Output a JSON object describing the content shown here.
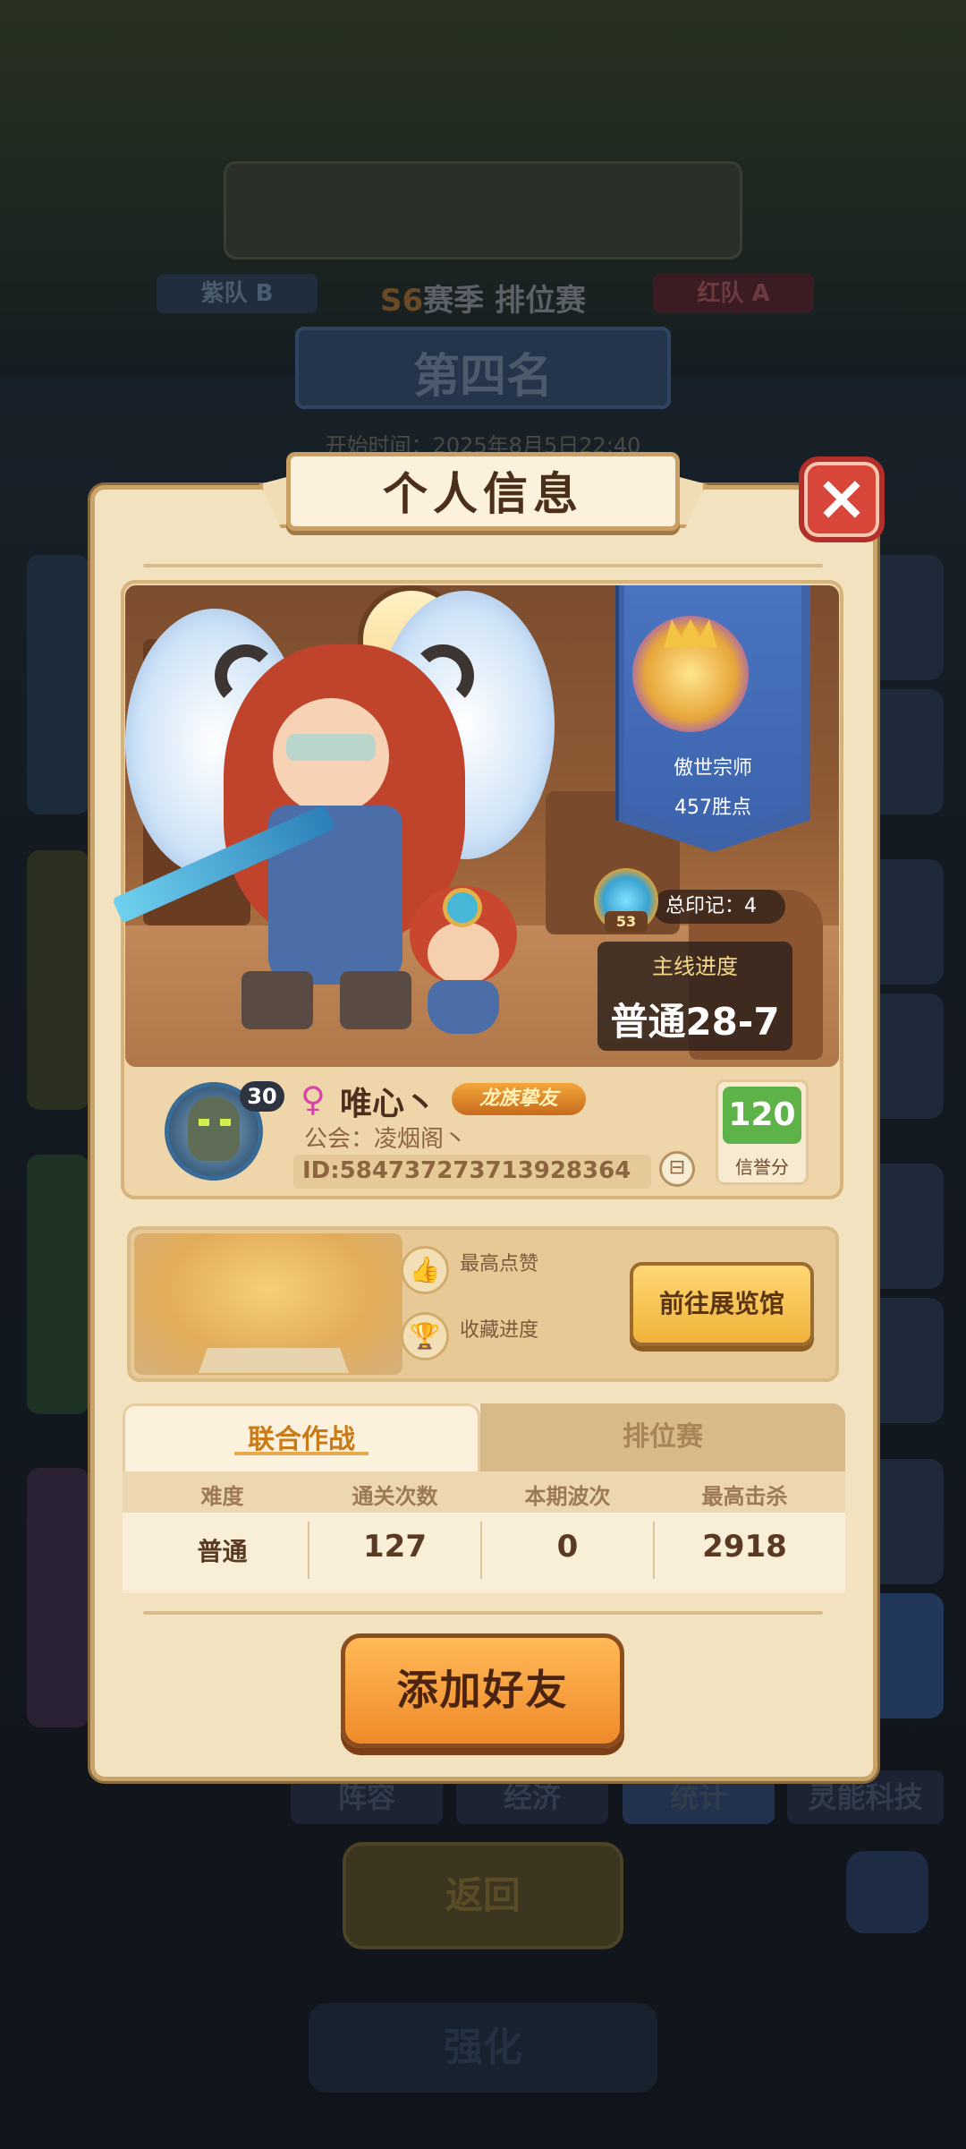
{
  "background": {
    "banner_text": "",
    "team_b": "紫队 B",
    "team_a": "红队 A",
    "season_prefix": "S6",
    "season_rest": "赛季 排位赛",
    "rank_plate": "第四名",
    "start_time": "开始时间：2025年8月5日22:40",
    "bottom_tabs": [
      "阵容",
      "经济",
      "统计",
      "灵能科技"
    ],
    "back_label": "返回",
    "strengthen_label": "强化"
  },
  "dialog": {
    "title": "个人信息",
    "close_icon": "close-icon",
    "rank": {
      "name": "傲世宗师",
      "points": "457胜点"
    },
    "marks": {
      "badge_number": "53",
      "label": "总印记：4"
    },
    "main_progress": {
      "label": "主线进度",
      "value": "普通28-7"
    },
    "profile": {
      "level": "30",
      "gender_symbol": "♀",
      "name": "唯心丶",
      "title_badge": "龙族挚友",
      "guild": "公会：凌烟阁丶",
      "id": "ID:584737273713928364",
      "credit_value": "120",
      "credit_label": "信誉分"
    },
    "exhibit": {
      "likes_label": "最高点赞",
      "collection_label": "收藏进度",
      "gallery_button": "前往展览馆"
    },
    "stats": {
      "tabs": [
        "联合作战",
        "排位赛"
      ],
      "active_tab": 0,
      "headers": [
        "难度",
        "通关次数",
        "本期波次",
        "最高击杀"
      ],
      "values": [
        "普通",
        "127",
        "0",
        "2918"
      ]
    },
    "add_friend_button": "添加好友"
  },
  "colors": {
    "dialog_bg": "#f3e2bf",
    "close_red": "#d84639",
    "accent_orange": "#f08a2a",
    "credit_green": "#5db348",
    "rank_blue": "#3f63a8"
  }
}
